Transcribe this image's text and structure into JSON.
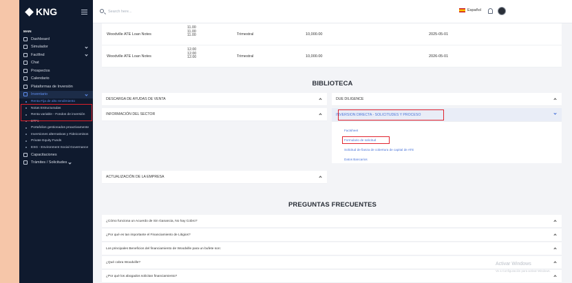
{
  "brand": {
    "name": "KNG"
  },
  "topbar": {
    "search_placeholder": "Search here...",
    "language": "Español"
  },
  "sidebar": {
    "section": "MAIN",
    "items": [
      {
        "label": "Dashboard",
        "icon": "home-icon"
      },
      {
        "label": "Simulador",
        "icon": "grid-icon",
        "chevron": true
      },
      {
        "label": "Factfind",
        "icon": "document-icon",
        "chevron": true
      },
      {
        "label": "Chat",
        "icon": "send-icon"
      },
      {
        "label": "Prospectos",
        "icon": "users-icon"
      },
      {
        "label": "Calendario",
        "icon": "calendar-icon"
      },
      {
        "label": "Plataformas de Inversión",
        "icon": "platform-icon"
      },
      {
        "label": "Inventario",
        "icon": "chart-icon",
        "chevron": true,
        "active": true
      }
    ],
    "sub_items": [
      "Renta Fija de alto rendimiento",
      "Notas Estructuradas",
      "Renta variable - Fondos de inversión",
      "ETFs",
      "Portafolios gestionados proactivamente",
      "Inversiones alternativas y Fideicomisos",
      "Private Equity Funds",
      "ESG - Environment Social Governance"
    ],
    "footer_items": [
      {
        "label": "Capacitaciones",
        "icon": "training-icon"
      },
      {
        "label": "Trámites / Solicitudes",
        "icon": "request-icon",
        "chevron": true
      }
    ]
  },
  "loans": [
    {
      "name": "Woodville ATE Loan Notes",
      "rates": [
        "11.00",
        "11.00",
        "11.00"
      ],
      "frequency": "Trimestral",
      "amount": "10,000.00",
      "maturity": "2025-05-01"
    },
    {
      "name": "Woodville ATE Loan Notes",
      "rates": [
        "12.00",
        "12.00",
        "12.00"
      ],
      "frequency": "Trimestral",
      "amount": "10,000.00",
      "maturity": "2026-05-01"
    }
  ],
  "biblioteca": {
    "title": "BIBLIOTECA",
    "left": [
      "DESCARGA DE AYUDAS DE VENTA",
      "INFORMACIÓN DEL SECTOR",
      "ACTUALIZACIÓN DE LA EMPRESA"
    ],
    "right": [
      "DUE DILIGENCE",
      "INVERSION DIRECTA - SOLICITUDES Y PROCESO"
    ],
    "links": [
      "Factsheet",
      "Formulario de solicitud",
      "Solicitud de fianza de cobertura de capital de ATE",
      "Datos Bancarios"
    ]
  },
  "faq": {
    "title": "PREGUNTAS FRECUENTES",
    "items": [
      "¿Cómo funciona un Acuerdo de Sin Ganancia, No hay Cobro?",
      "¿Por qué es tan importante el Financiamiento de Litigios?",
      "Los principales Beneficios del financiamiento de Woodville para un bufete son:",
      "¿Qué cobra Woodville?",
      "¿Por qué los abogados solicitan financiamiento?"
    ]
  },
  "watermark": {
    "title": "Activar Windows",
    "subtitle": "Ve a Configuración para activar Windows."
  },
  "colors": {
    "sidebar": "#0f1a2e",
    "accent": "#4a74d9",
    "highlight_box": "#e0202b"
  }
}
